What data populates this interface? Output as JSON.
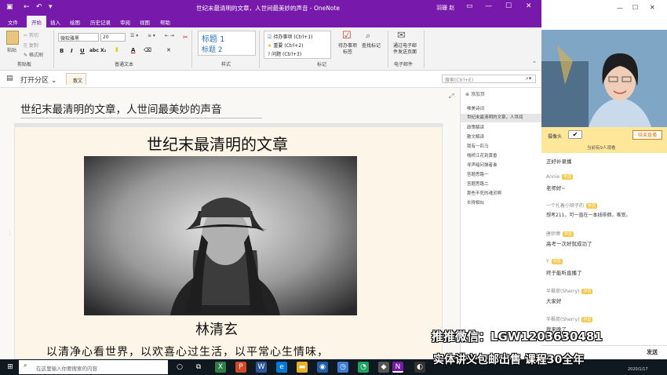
{
  "window": {
    "title": "世纪末最清明的文章，人世间最美妙的声音 - OneNote",
    "user": "羽珊 赵"
  },
  "tabs": [
    "文件",
    "开始",
    "插入",
    "绘图",
    "历史记录",
    "审阅",
    "视图",
    "帮助"
  ],
  "ribbon": {
    "paste": "粘贴",
    "cut": "剪切",
    "copy": "复制",
    "format_painter": "格式刷",
    "clipboard_group": "剪贴板",
    "font_name": "微软雅黑",
    "font_size": "20",
    "basic_text_group": "普通文本",
    "heading1": "标题 1",
    "heading2": "标题 2",
    "styles_group": "样式",
    "tags": [
      {
        "icon": "checkbox-icon",
        "label": "待办事项 (Ctrl+1)"
      },
      {
        "icon": "star-icon",
        "label": "重要 (Ctrl+2)"
      },
      {
        "icon": "question-icon",
        "label": "问题 (Ctrl+3)"
      }
    ],
    "todo_tag": "待办事项\n标签",
    "find_tags": "查找标记",
    "tags_group": "标记",
    "email_page": "通过电子邮\n件发送页面",
    "email_group": "电子邮件"
  },
  "nav": {
    "open_section": "打开分区",
    "section_tab": "散文",
    "search_placeholder": "搜索(Ctrl+E)"
  },
  "page": {
    "title": "世纪末最清明的文章，人世间最美妙的声音",
    "heading": "世纪末最清明的文章",
    "author": "林清玄",
    "quote": "以清净心看世界，以欢喜心过生活，以平常心生情味，"
  },
  "pagelist": {
    "add_page": "添加页",
    "pages": [
      "唯美诗词",
      "世纪末最清明的文章，人世间",
      "政策解读",
      "散文解读",
      "我有一匹马",
      "栈桥江花到黄昏",
      "寻声暗问弹者谁",
      "答题思路一",
      "答题思路二",
      "那些不死的魂灵啊",
      "长得相似"
    ],
    "selected_index": 1
  },
  "live": {
    "camera_label": "摄像头",
    "end_button": "结束直播",
    "viewers": "当前有9人观看",
    "chat": [
      {
        "name": "",
        "badge": "",
        "msg": "正好补录播"
      },
      {
        "name": "Annie",
        "badge": "学员",
        "msg": "老师好~"
      },
      {
        "name": "一个扎着小辫子的",
        "badge": "学员",
        "msg": "想考211，可一直在一本线徘徊，难受。"
      },
      {
        "name": "唐师博",
        "badge": "学员",
        "msg": "高考一次好就成功了"
      },
      {
        "name": "Y",
        "badge": "学员",
        "msg": "终于能听直播了"
      },
      {
        "name": "半枫荷(Sherry)",
        "badge": "学员",
        "msg": "大家好"
      },
      {
        "name": "半枫荷(Sherry)",
        "badge": "学员",
        "msg": "我来晚了"
      }
    ],
    "send_button": "发送"
  },
  "taskbar": {
    "search_placeholder": "在这里输入你要搜索的内容",
    "clock_date": "2020/1/17"
  },
  "watermark": {
    "line1": "推推微信：LGW1203630481",
    "line2": "实体讲义包邮出售 课程30全年"
  },
  "colors": {
    "onenote_purple": "#7719aa",
    "accent_yellow": "#ffe79a",
    "badge_yellow": "#f7c948"
  }
}
